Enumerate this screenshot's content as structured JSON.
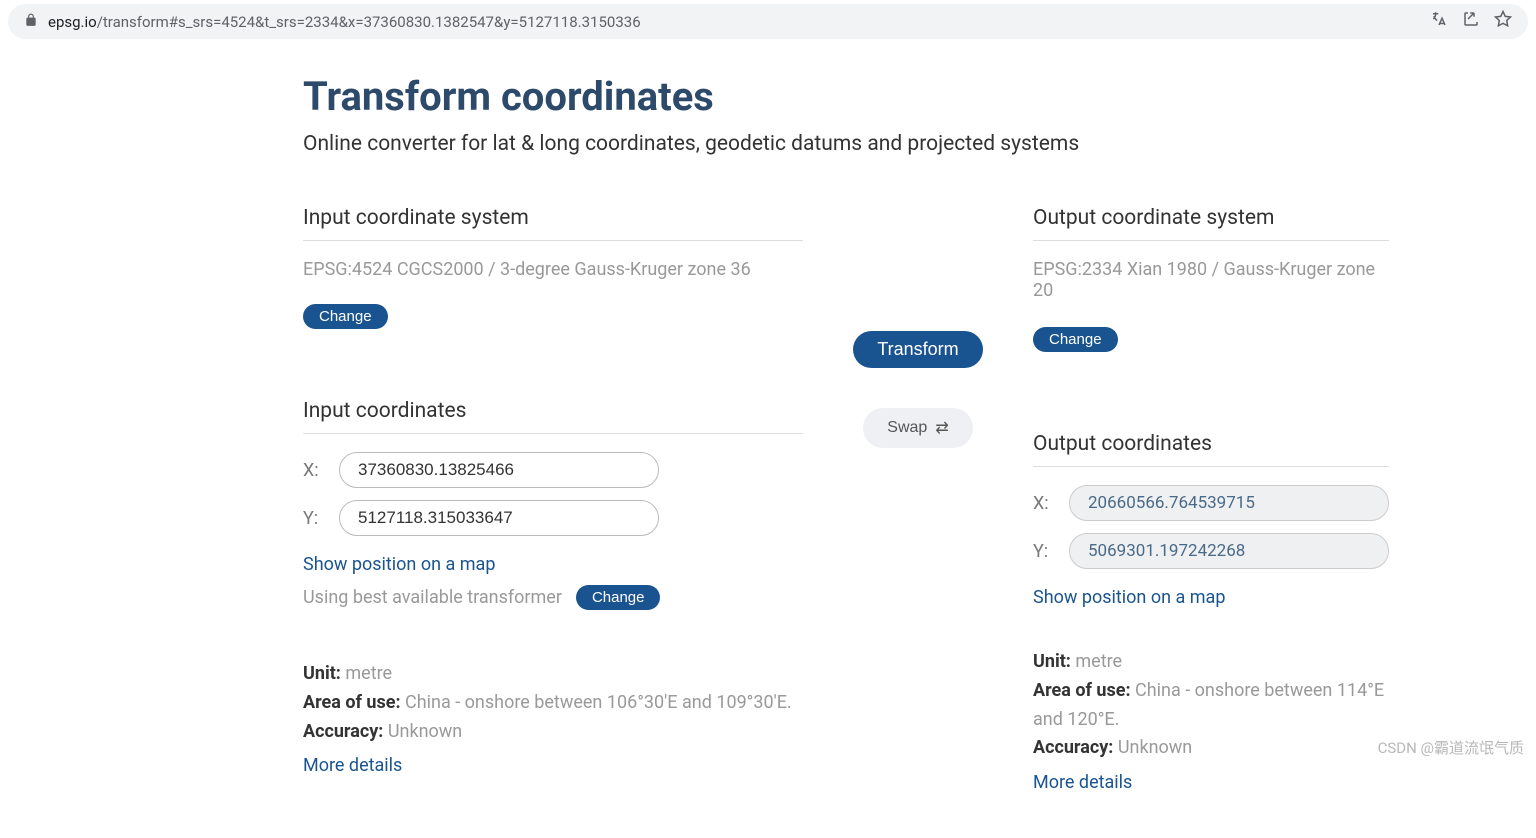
{
  "url": {
    "domain": "epsg.io",
    "path": "/transform#s_srs=4524&t_srs=2334&x=37360830.1382547&y=5127118.3150336"
  },
  "header": {
    "title": "Transform coordinates",
    "subtitle": "Online converter for lat & long coordinates, geodetic datums and projected systems"
  },
  "input": {
    "system_title": "Input coordinate system",
    "crs_name": "EPSG:4524 CGCS2000 / 3-degree Gauss-Kruger zone 36",
    "change_label": "Change",
    "coords_title": "Input coordinates",
    "x_label": "X:",
    "y_label": "Y:",
    "x_value": "37360830.13825466",
    "y_value": "5127118.315033647",
    "show_map": "Show position on a map",
    "transformer_text": "Using best available transformer",
    "transformer_change": "Change",
    "unit_label": "Unit:",
    "unit_value": "metre",
    "area_label": "Area of use:",
    "area_value": "China - onshore between 106°30'E and 109°30'E.",
    "accuracy_label": "Accuracy:",
    "accuracy_value": "Unknown",
    "more_details": "More details"
  },
  "actions": {
    "transform": "Transform",
    "swap": "Swap"
  },
  "output": {
    "system_title": "Output coordinate system",
    "crs_name": "EPSG:2334 Xian 1980 / Gauss-Kruger zone 20",
    "change_label": "Change",
    "coords_title": "Output coordinates",
    "x_label": "X:",
    "y_label": "Y:",
    "x_value": "20660566.764539715",
    "y_value": "5069301.197242268",
    "show_map": "Show position on a map",
    "unit_label": "Unit:",
    "unit_value": "metre",
    "area_label": "Area of use:",
    "area_value": "China - onshore between 114°E and 120°E.",
    "accuracy_label": "Accuracy:",
    "accuracy_value": "Unknown",
    "more_details": "More details"
  },
  "watermark": "CSDN @霸道流氓气质"
}
